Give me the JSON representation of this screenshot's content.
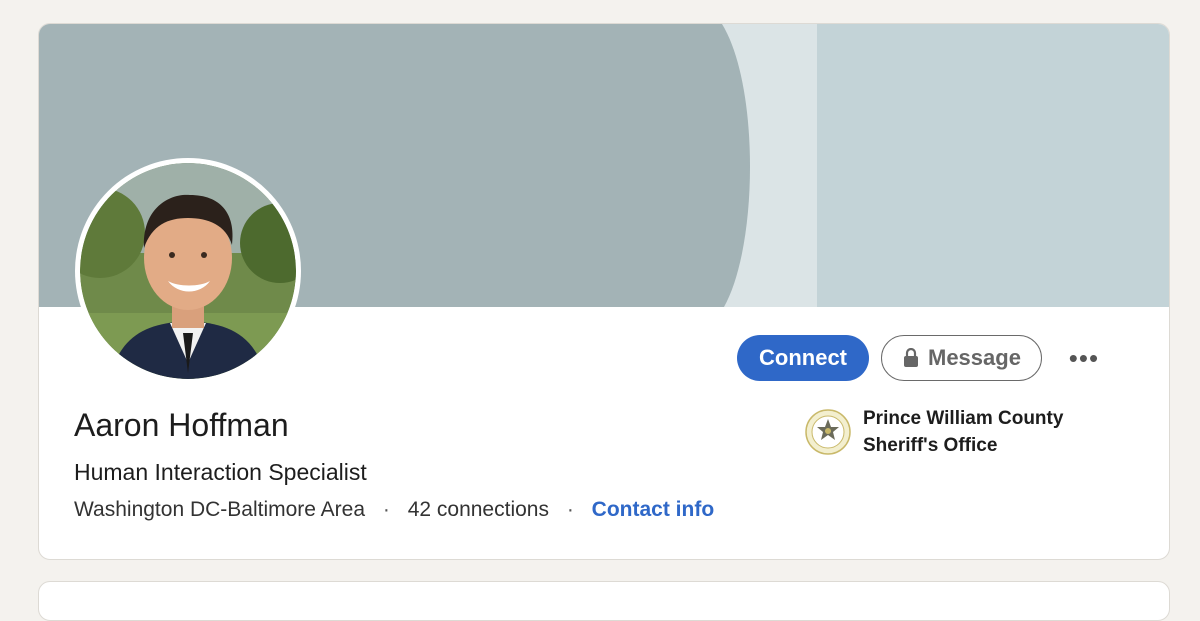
{
  "profile": {
    "name": "Aaron Hoffman",
    "headline": "Human Interaction Specialist",
    "location": "Washington DC-Baltimore Area",
    "separator": "·",
    "connections": "42 connections",
    "contact_info": "Contact info"
  },
  "actions": {
    "connect_label": "Connect",
    "message_label": "Message",
    "more_label": "•••"
  },
  "organization": {
    "line1": "Prince William County",
    "line2": "Sheriff's Office",
    "logo_icon": "sheriff-badge-seal-icon"
  },
  "colors": {
    "accent": "#2f68c8",
    "banner_dark": "#a3b3b6",
    "banner_light": "#c3d3d7",
    "banner_stripe": "#dbe4e6",
    "page_background": "#f4f2ee"
  },
  "icons": {
    "lock": "lock-icon",
    "more": "more-horizontal-icon"
  }
}
